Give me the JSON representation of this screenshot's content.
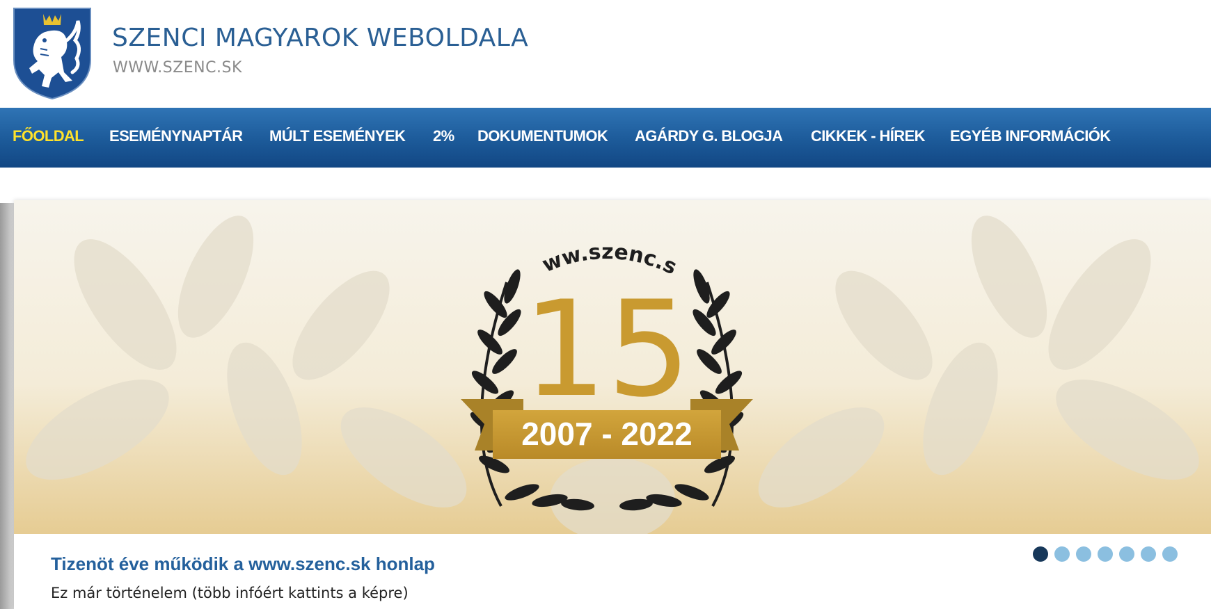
{
  "header": {
    "title": "SZENCI MAGYAROK WEBOLDALA",
    "subtitle": "WWW.SZENC.SK"
  },
  "nav": {
    "items": [
      {
        "label": "FŐOLDAL",
        "active": true
      },
      {
        "label": "ESEMÉNYNAPTÁR",
        "active": false
      },
      {
        "label": "MÚLT ESEMÉNYEK",
        "active": false
      },
      {
        "label": "2%",
        "active": false
      },
      {
        "label": "DOKUMENTUMOK",
        "active": false
      },
      {
        "label": "AGÁRDY G. BLOGJA",
        "active": false
      },
      {
        "label": "CIKKEK - HÍREK",
        "active": false
      },
      {
        "label": "EGYÉB INFORMÁCIÓK",
        "active": false
      }
    ]
  },
  "slider": {
    "banner": {
      "arc_text": "www.szenc.sk",
      "number": "15",
      "years": "2007 - 2022"
    },
    "caption_title": "Tizenöt éve működik a www.szenc.sk honlap",
    "caption_text": "Ez már történelem (több infóért kattints a képre)",
    "slide_count": 7,
    "active_slide": 1
  },
  "colors": {
    "brand_blue": "#2a5f94",
    "nav_active": "#ffe22a",
    "gold": "#c99a30",
    "dot_active": "#17385a",
    "dot_inactive": "#8bbfe0"
  },
  "icons": {
    "logo": "coat-of-arms-lion-icon"
  }
}
